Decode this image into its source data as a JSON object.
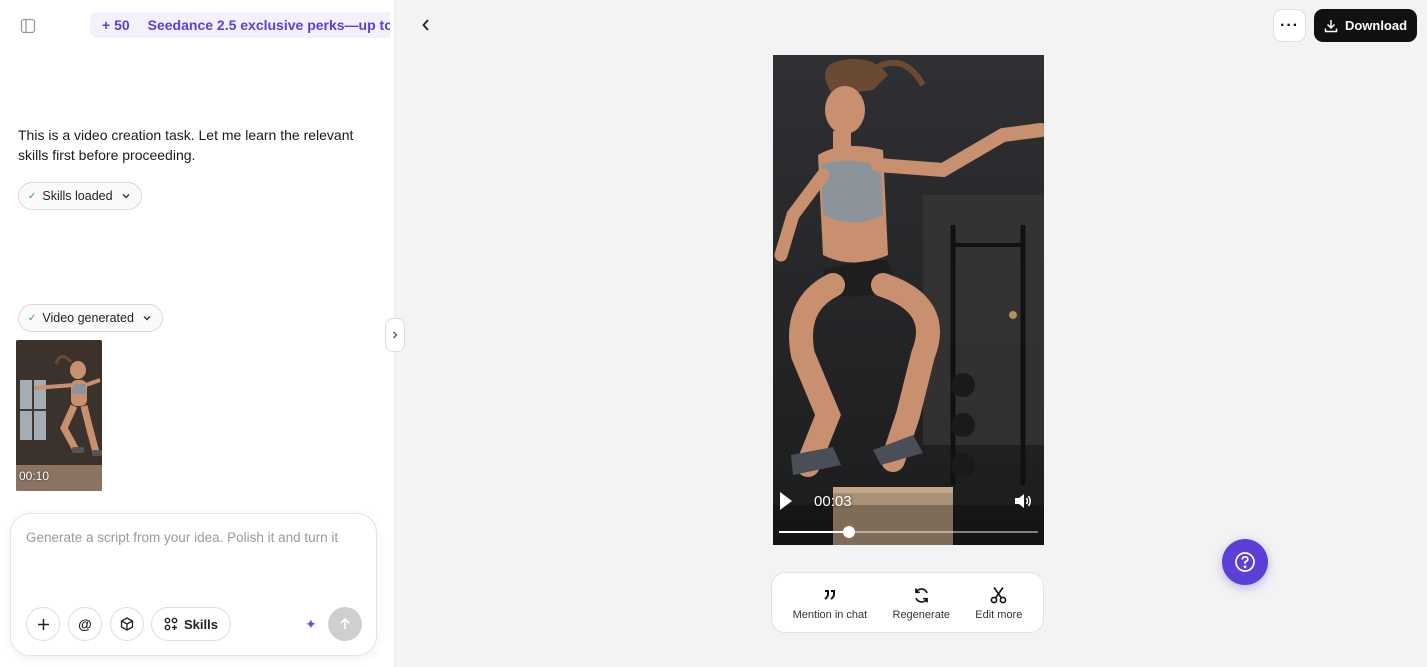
{
  "colors": {
    "accent": "#5b3fd6",
    "promo_bg": "#f3f1fc",
    "success": "#22a06b",
    "panel_bg": "#f3f3f3"
  },
  "sidebar": {
    "toggle_icon": "sidebar-panel-icon",
    "promo": {
      "points": "+ 50",
      "text": "Seedance 2.5 exclusive perks—up to"
    }
  },
  "chat": {
    "message": "This is a video creation task. Let me learn the relevant skills first before proceeding.",
    "chips": [
      {
        "label": "Skills loaded"
      },
      {
        "label": "Video generated"
      }
    ],
    "thumbnail": {
      "duration": "00:10"
    }
  },
  "composer": {
    "placeholder": "Generate a script from your idea. Polish it and turn it",
    "skills_label": "Skills",
    "buttons": [
      "plus-icon",
      "at-icon",
      "cube-icon",
      "skills-icon",
      "sparkle-icon",
      "arrow-up-icon"
    ]
  },
  "toolbar": {
    "more_label": "···",
    "download_label": "Download"
  },
  "player": {
    "current_time": "00:03",
    "progress": 0.27
  },
  "actions": [
    {
      "label": "Mention in chat",
      "icon": "quote-icon"
    },
    {
      "label": "Regenerate",
      "icon": "refresh-icon"
    },
    {
      "label": "Edit more",
      "icon": "scissors-icon"
    }
  ]
}
